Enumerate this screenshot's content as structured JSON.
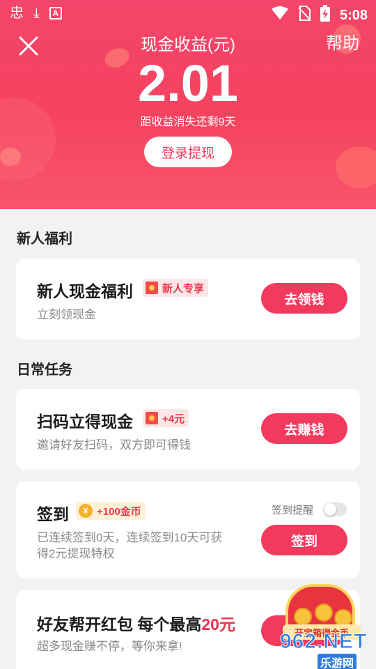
{
  "status_bar": {
    "left_icons": [
      "app-logo-icon",
      "download-icon",
      "text-a-icon"
    ],
    "left_glyphs": [
      "忠",
      "⤓",
      "A"
    ],
    "right_icons": [
      "wifi-icon",
      "no-sim-icon",
      "battery-charging-icon"
    ],
    "right_glyphs": [
      "▼",
      "◪",
      "▮"
    ],
    "time": "5:08"
  },
  "header": {
    "title": "现金收益(元)",
    "help_label": "帮助",
    "amount": "2.01",
    "expire_note": "距收益消失还剩9天",
    "login_button": "登录提现",
    "colors": {
      "gradient_top": "#f4456a",
      "gradient_bottom": "#f8546a"
    }
  },
  "sections": {
    "newbie": "新人福利",
    "daily": "日常任务"
  },
  "cards": {
    "newbie_cash": {
      "title": "新人现金福利",
      "tag": "新人专享",
      "tag_icon": "red-envelope-icon",
      "subtitle": "立刻领现金",
      "button": "去领钱"
    },
    "scan_code": {
      "title": "扫码立得现金",
      "tag": "+4元",
      "tag_icon": "red-envelope-icon",
      "subtitle": "邀请好友扫码，双方即可得钱",
      "button": "去赚钱"
    },
    "sign_in": {
      "title": "签到",
      "tag": "+100金币",
      "tag_icon": "coin-icon",
      "coin_glyph": "¥",
      "reminder_label": "签到提醒",
      "reminder_on": false,
      "subtitle_line1": "已连续签到0天，连续签到10天可获",
      "subtitle_line2": "得2元提现特权",
      "button": "签到"
    },
    "friend_red_packet": {
      "title_prefix": "好友帮开红包 每个最高",
      "title_highlight": "20元",
      "subtitle": "超多现金赚不停，等你来拿!",
      "button": "去"
    }
  },
  "floating": {
    "treasure_label": "开宝箱得金币"
  },
  "watermark": {
    "main": "962.NET",
    "sub": "乐游网"
  },
  "accent_color": "#f23a5f"
}
